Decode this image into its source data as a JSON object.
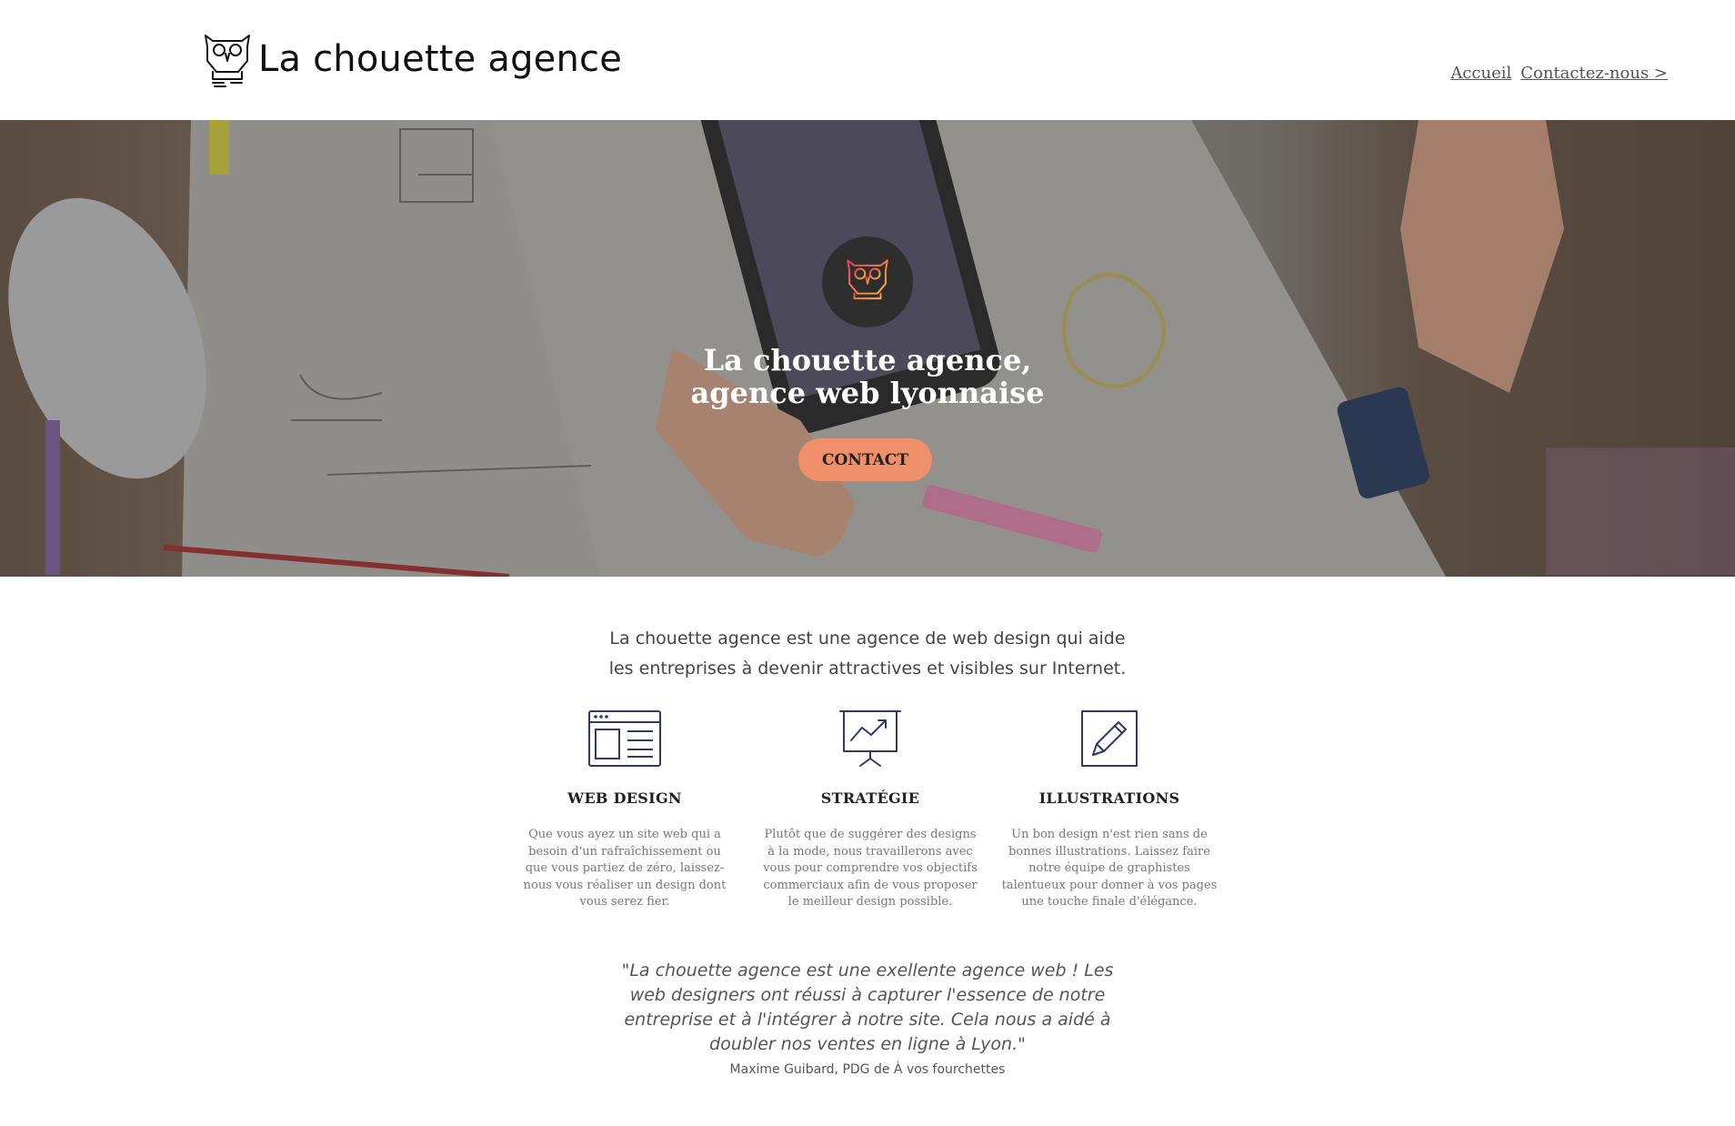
{
  "header": {
    "brand": "La chouette agence",
    "logo_icon": "owl-icon",
    "nav": [
      {
        "label": "Accueil"
      },
      {
        "label": "Contactez-nous >"
      }
    ]
  },
  "hero": {
    "badge_icon": "owl-icon",
    "title_line1": "La chouette agence,",
    "title_line2": "agence web lyonnaise",
    "cta_label": "CONTACT",
    "cta_color": "#f0906a"
  },
  "intro": {
    "line1": "La chouette agence est une agence de web design qui aide",
    "line2": "les entreprises à devenir attractives et visibles sur Internet."
  },
  "services": [
    {
      "icon": "browser-window-icon",
      "title": "WEB DESIGN",
      "text": "Que vous ayez un site web qui a besoin d'un rafraîchissement ou que vous partiez de zéro, laissez-nous vous réaliser un design dont vous serez fier."
    },
    {
      "icon": "presentation-chart-icon",
      "title": "STRATÉGIE",
      "text": "Plutôt que de suggérer des designs à la mode, nous travaillerons avec vous pour comprendre vos objectifs commerciaux afin de vous proposer le meilleur design possible."
    },
    {
      "icon": "pencil-icon",
      "title": "ILLUSTRATIONS",
      "text": "Un bon design n'est rien sans de bonnes illustrations. Laissez faire notre équipe de graphistes talentueux pour donner à vos pages une touche finale d'élégance."
    }
  ],
  "testimonial": {
    "quote": "\"La chouette agence est une exellente agence web ! Les web designers ont réussi à capturer l'essence de notre entreprise et à l'intégrer à notre site. Cela nous a aidé à doubler nos ventes en ligne à Lyon.\"",
    "author": "Maxime Guibard, PDG de À vos fourchettes"
  },
  "colors": {
    "accent": "#f0906a",
    "icon_navy": "#2f3a6b"
  }
}
